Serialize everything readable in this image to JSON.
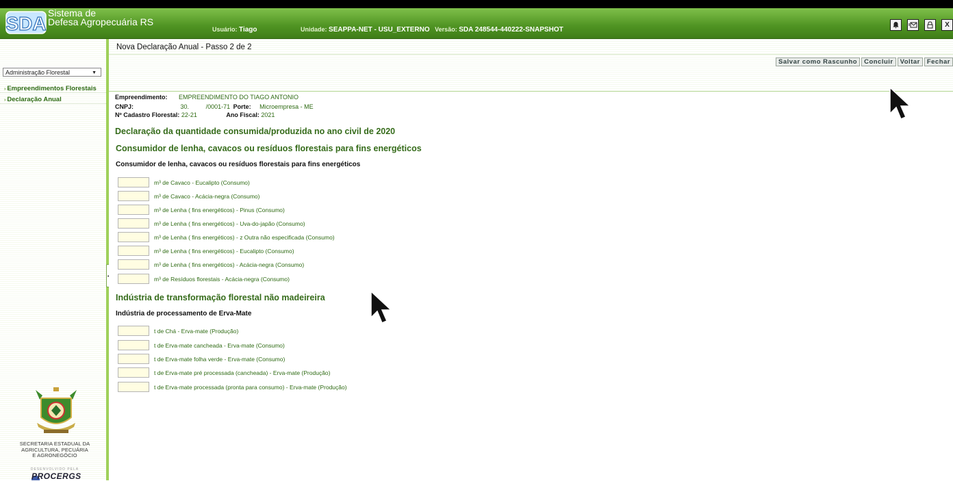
{
  "header": {
    "app_title_line1": "Sistema de",
    "app_title_line2": "Defesa Agropecuária RS",
    "usuario_label": "Usuário:",
    "usuario_value": "Tiago",
    "unidade_label": "Unidade:",
    "unidade_value": "SEAPPA-NET - USU_EXTERNO",
    "versao_label": "Versão:",
    "versao_value": "SDA 248544-440222-SNAPSHOT",
    "buttons": [
      {
        "icon": "bell-icon"
      },
      {
        "icon": "mail-icon"
      },
      {
        "icon": "lock-icon"
      },
      {
        "label": "X"
      }
    ]
  },
  "sidebar": {
    "module_select": "Administração Florestal",
    "links": [
      "Empreendimentos Florestais",
      "Declaração Anual"
    ],
    "footer_lines": [
      "SECRETARIA ESTADUAL DA",
      "AGRICULTURA, PECUÁRIA",
      "E AGRONEGÓCIO"
    ],
    "developed_by": "DESENVOLVIDO PELA",
    "procergs": "PROCERGS"
  },
  "page": {
    "title": "Nova Declaração Anual - Passo 2 de 2",
    "toolbar": {
      "save_draft": "Salvar como Rascunho",
      "conclude": "Concluir",
      "back": "Voltar",
      "close": "Fechar"
    }
  },
  "info": {
    "empreendimento_label": "Empreendimento:",
    "empreendimento_value": "EMPREENDIMENTO DO TIAGO ANTONIO",
    "cnpj_label": "CNPJ:",
    "cnpj_value_a": "30.",
    "cnpj_value_b": "/0001-71",
    "porte_label": "Porte:",
    "porte_value": "Microempresa - ME",
    "cadastro_label": "Nº Cadastro Florestal:",
    "cadastro_value": "22-21",
    "ano_fiscal_label": "Ano Fiscal:",
    "ano_fiscal_value": "2021"
  },
  "declaration": {
    "heading": "Declaração da quantidade consumida/produzida no ano civil de 2020",
    "sections": [
      {
        "title": "Consumidor de lenha, cavacos ou resíduos florestais para fins energéticos",
        "subtitle": "Consumidor de lenha, cavacos ou resíduos florestais para fins energéticos",
        "fields": [
          {
            "label": "m³ de Cavaco - Eucalipto (Consumo)",
            "value": ""
          },
          {
            "label": "m³ de Cavaco - Acácia-negra (Consumo)",
            "value": ""
          },
          {
            "label": "m³ de Lenha ( fins energéticos) - Pinus (Consumo)",
            "value": ""
          },
          {
            "label": "m³ de Lenha ( fins energéticos) - Uva-do-japão (Consumo)",
            "value": ""
          },
          {
            "label": "m³ de Lenha ( fins energéticos) - z Outra não especificada (Consumo)",
            "value": ""
          },
          {
            "label": "m³ de Lenha ( fins energéticos) - Eucalipto (Consumo)",
            "value": ""
          },
          {
            "label": "m³ de Lenha ( fins energéticos) - Acácia-negra (Consumo)",
            "value": ""
          },
          {
            "label": "m³ de Resíduos florestais - Acácia-negra (Consumo)",
            "value": ""
          }
        ]
      },
      {
        "title": "Indústria de transformação florestal não madeireira",
        "subtitle": "Indústria de processamento de Erva-Mate",
        "fields": [
          {
            "label": "t de Chá - Erva-mate (Produção)",
            "value": ""
          },
          {
            "label": "t de Erva-mate cancheada - Erva-mate (Consumo)",
            "value": ""
          },
          {
            "label": "t de Erva-mate folha verde - Erva-mate (Consumo)",
            "value": ""
          },
          {
            "label": "t de Erva-mate pré processada (cancheada) - Erva-mate (Produção)",
            "value": ""
          },
          {
            "label": "t de Erva-mate processada (pronta para consumo) - Erva-mate (Produção)",
            "value": ""
          }
        ]
      }
    ]
  }
}
